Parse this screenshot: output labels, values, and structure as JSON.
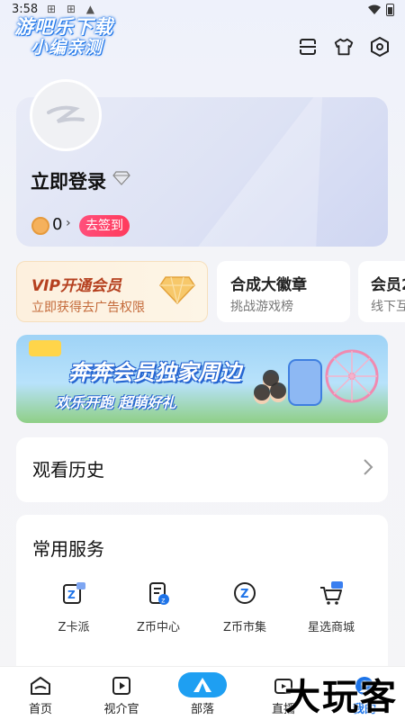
{
  "status_bar": {
    "time": "3:58",
    "icons": "⊞ ⊞ ▲"
  },
  "watermark": {
    "line1": "游吧乐下载",
    "line2": "小编亲测",
    "corner": "大玩客"
  },
  "top_icons": [
    "scan-icon",
    "shirt-icon",
    "settings-hex-icon"
  ],
  "profile": {
    "login_label": "立即登录",
    "coin_count": "0",
    "coin_arrow": "›",
    "checkin_label": "去签到"
  },
  "cards": [
    {
      "title": "VIP开通会员",
      "subtitle": "立即获得去广告权限"
    },
    {
      "title": "合成大徽章",
      "subtitle": "挑战游戏榜"
    },
    {
      "title": "会员2",
      "subtitle": "线下互"
    }
  ],
  "banner": {
    "title": "奔奔会员独家周边",
    "subtitle": "欢乐开跑  超萌好礼"
  },
  "history": {
    "label": "观看历史"
  },
  "services": {
    "title": "常用服务",
    "items": [
      {
        "label": "Z卡派",
        "icon": "z-card-icon"
      },
      {
        "label": "Z币中心",
        "icon": "z-coin-center-icon"
      },
      {
        "label": "Z币市集",
        "icon": "z-market-icon"
      },
      {
        "label": "星选商城",
        "icon": "cart-icon"
      }
    ]
  },
  "bottom_nav": [
    {
      "label": "首页",
      "icon": "home-icon"
    },
    {
      "label": "视介官",
      "icon": "video-icon"
    },
    {
      "label": "部落",
      "icon": "tent-icon"
    },
    {
      "label": "直播",
      "icon": "tv-icon"
    },
    {
      "label": "我的",
      "icon": "profile-icon"
    }
  ],
  "colors": {
    "accent": "#1e9ff2",
    "vip": "#b5401f",
    "checkin": "#ff3b5c"
  }
}
